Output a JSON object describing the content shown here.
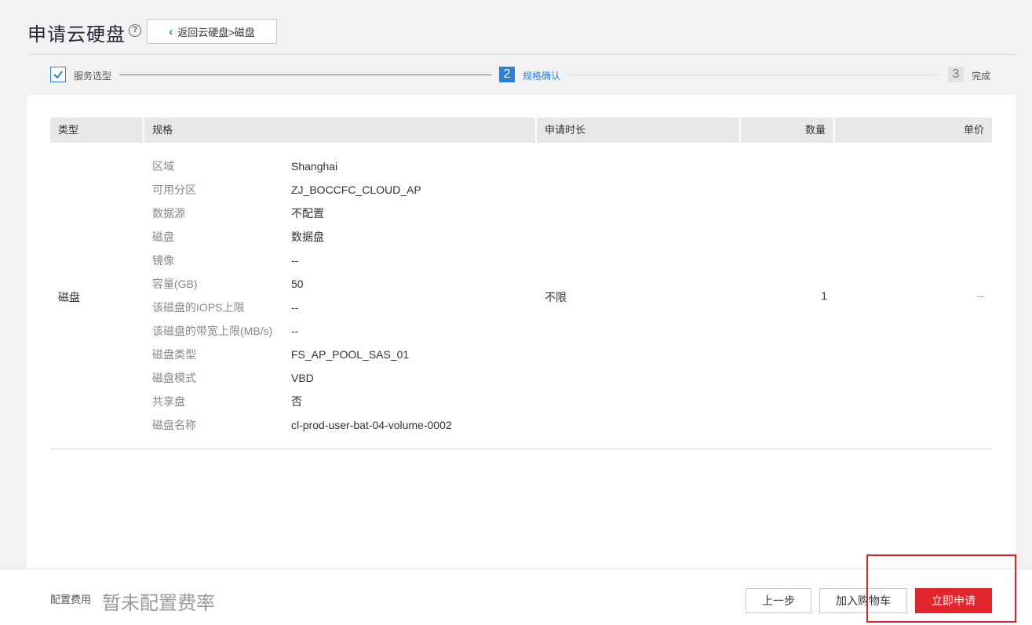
{
  "header": {
    "title": "申请云硬盘",
    "help_icon": "?",
    "back_label": "返回云硬盘>磁盘"
  },
  "steps": [
    {
      "num": "1",
      "label": "服务选型",
      "state": "done"
    },
    {
      "num": "2",
      "label": "规格确认",
      "state": "active"
    },
    {
      "num": "3",
      "label": "完成",
      "state": "pending"
    }
  ],
  "table": {
    "columns": [
      "类型",
      "规格",
      "申请时长",
      "数量",
      "单价"
    ],
    "row": {
      "type": "磁盘",
      "specs": [
        {
          "key": "区域",
          "value": "Shanghai"
        },
        {
          "key": "可用分区",
          "value": "ZJ_BOCCFC_CLOUD_AP"
        },
        {
          "key": "数据源",
          "value": "不配置"
        },
        {
          "key": "磁盘",
          "value": "数据盘"
        },
        {
          "key": "镜像",
          "value": "--"
        },
        {
          "key": "容量(GB)",
          "value": "50"
        },
        {
          "key": "该磁盘的IOPS上限",
          "value": "--"
        },
        {
          "key": "该磁盘的带宽上限(MB/s)",
          "value": "--"
        },
        {
          "key": "磁盘类型",
          "value": "FS_AP_POOL_SAS_01"
        },
        {
          "key": "磁盘模式",
          "value": "VBD"
        },
        {
          "key": "共享盘",
          "value": "否"
        },
        {
          "key": "磁盘名称",
          "value": "cl-prod-user-bat-04-volume-0002"
        }
      ],
      "duration": "不限",
      "quantity": "1",
      "price": "--"
    }
  },
  "footer": {
    "fee_label": "配置费用",
    "fee_value": "暂未配置费率",
    "prev_label": "上一步",
    "cart_label": "加入购物车",
    "submit_label": "立即申请"
  },
  "colors": {
    "accent": "#2d7fd8",
    "submit": "#e1252c",
    "highlight": "#d62828"
  }
}
